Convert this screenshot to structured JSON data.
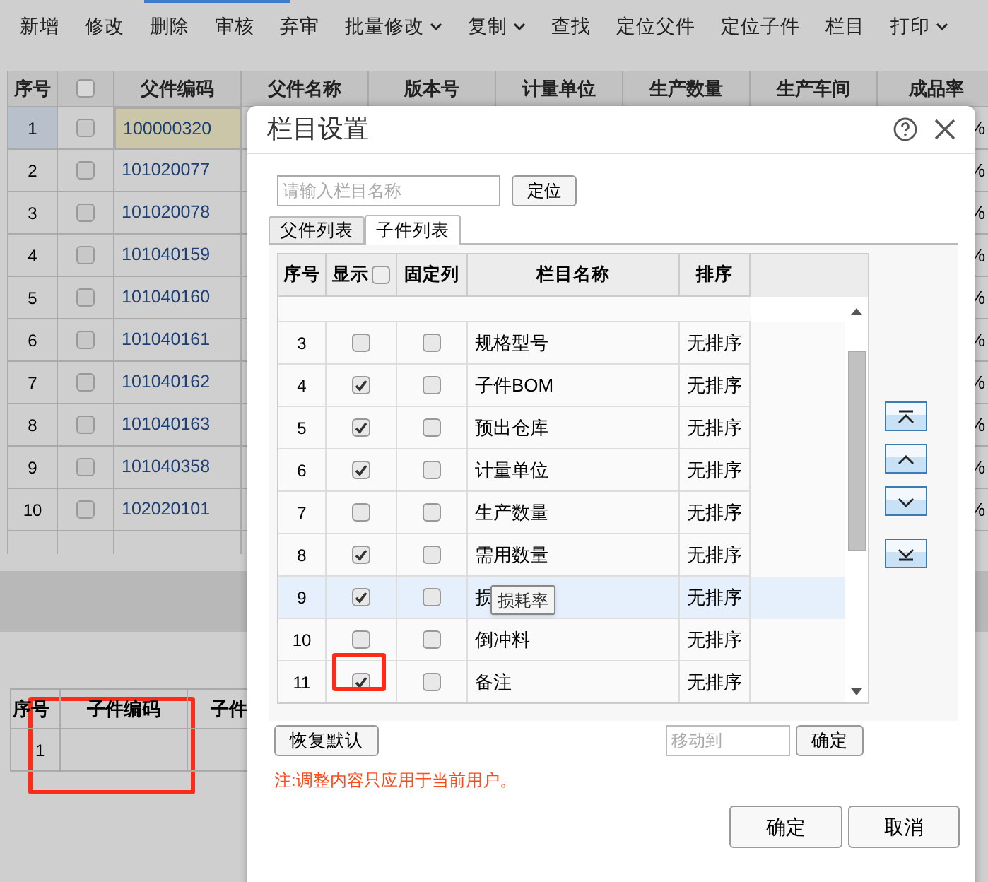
{
  "toolbar": [
    {
      "label": "新增",
      "dropdown": false
    },
    {
      "label": "修改",
      "dropdown": false
    },
    {
      "label": "删除",
      "dropdown": false
    },
    {
      "label": "审核",
      "dropdown": false
    },
    {
      "label": "弃审",
      "dropdown": false
    },
    {
      "label": "批量修改",
      "dropdown": true
    },
    {
      "label": "复制",
      "dropdown": true
    },
    {
      "label": "查找",
      "dropdown": false
    },
    {
      "label": "定位父件",
      "dropdown": false
    },
    {
      "label": "定位子件",
      "dropdown": false
    },
    {
      "label": "栏目",
      "dropdown": false
    },
    {
      "label": "打印",
      "dropdown": true
    }
  ],
  "main_table": {
    "header_checked": false,
    "columns": [
      "序号",
      "父件编码",
      "父件名称",
      "版本号",
      "计量单位",
      "生产数量",
      "生产车间",
      "成品率"
    ],
    "rows": [
      {
        "index": "1",
        "code": "100000320",
        "checked": false,
        "selected": true,
        "yield": "%"
      },
      {
        "index": "2",
        "code": "101020077",
        "checked": false,
        "selected": false,
        "yield": "%"
      },
      {
        "index": "3",
        "code": "101020078",
        "checked": false,
        "selected": false,
        "yield": "%"
      },
      {
        "index": "4",
        "code": "101040159",
        "checked": false,
        "selected": false,
        "yield": "%"
      },
      {
        "index": "5",
        "code": "101040160",
        "checked": false,
        "selected": false,
        "yield": "%"
      },
      {
        "index": "6",
        "code": "101040161",
        "checked": false,
        "selected": false,
        "yield": "%"
      },
      {
        "index": "7",
        "code": "101040162",
        "checked": false,
        "selected": false,
        "yield": "%"
      },
      {
        "index": "8",
        "code": "101040163",
        "checked": false,
        "selected": false,
        "yield": "%"
      },
      {
        "index": "9",
        "code": "101040358",
        "checked": false,
        "selected": false,
        "yield": "%"
      },
      {
        "index": "10",
        "code": "102020101",
        "checked": false,
        "selected": false,
        "yield": "%"
      }
    ]
  },
  "bottom_table": {
    "columns": [
      "序号",
      "子件编码",
      "子件"
    ],
    "rows": [
      {
        "index": "1"
      }
    ]
  },
  "dialog": {
    "title": "栏目设置",
    "search": {
      "placeholder": "请输入栏目名称"
    },
    "locate_button": "定位",
    "tabs": [
      {
        "label": "父件列表",
        "selected": false
      },
      {
        "label": "子件列表",
        "selected": true
      }
    ],
    "grid": {
      "columns": [
        "序号",
        "显示",
        "固定列",
        "栏目名称",
        "排序"
      ],
      "show_all_checked": false,
      "rows": [
        {
          "index": "3",
          "show": false,
          "fixed": false,
          "name": "规格型号",
          "sort": "无排序",
          "selected": false
        },
        {
          "index": "4",
          "show": true,
          "fixed": false,
          "name": "子件BOM",
          "sort": "无排序",
          "selected": false
        },
        {
          "index": "5",
          "show": true,
          "fixed": false,
          "name": "预出仓库",
          "sort": "无排序",
          "selected": false
        },
        {
          "index": "6",
          "show": true,
          "fixed": false,
          "name": "计量单位",
          "sort": "无排序",
          "selected": false
        },
        {
          "index": "7",
          "show": false,
          "fixed": false,
          "name": "生产数量",
          "sort": "无排序",
          "selected": false
        },
        {
          "index": "8",
          "show": true,
          "fixed": false,
          "name": "需用数量",
          "sort": "无排序",
          "selected": false
        },
        {
          "index": "9",
          "show": true,
          "fixed": false,
          "name": "损",
          "sort": "无排序",
          "selected": true
        },
        {
          "index": "10",
          "show": false,
          "fixed": false,
          "name": "倒冲料",
          "sort": "无排序",
          "selected": false
        },
        {
          "index": "11",
          "show": true,
          "fixed": false,
          "name": "备注",
          "sort": "无排序",
          "selected": false
        }
      ]
    },
    "tooltip": "损耗率",
    "restore_button": "恢复默认",
    "move_to": {
      "placeholder": "移动到"
    },
    "move_confirm": "确定",
    "note": "注:调整内容只应用于当前用户。",
    "ok_button": "确定",
    "cancel_button": "取消"
  }
}
